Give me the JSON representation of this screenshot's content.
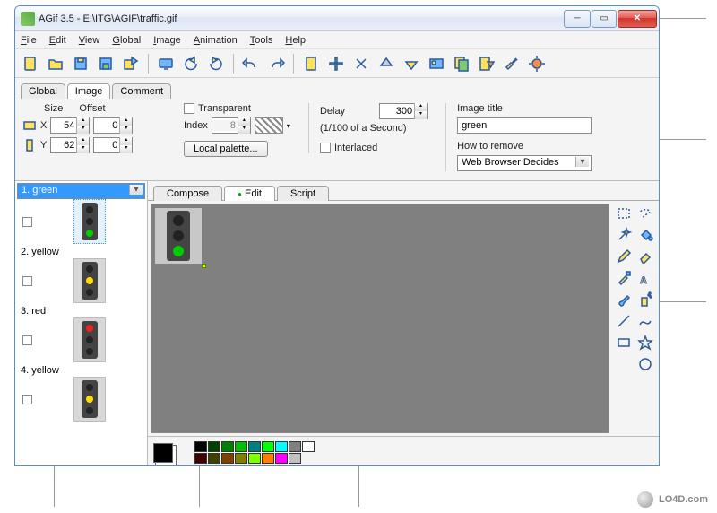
{
  "window": {
    "title": "AGif 3.5 - E:\\ITG\\AGIF\\traffic.gif"
  },
  "menu": {
    "file": "File",
    "edit": "Edit",
    "view": "View",
    "global": "Global",
    "image": "Image",
    "animation": "Animation",
    "tools": "Tools",
    "help": "Help"
  },
  "main_tabs": {
    "global": "Global",
    "image": "Image",
    "comment": "Comment"
  },
  "panel": {
    "size_label": "Size",
    "offset_label": "Offset",
    "x_label": "X",
    "x_size": "54",
    "x_offset": "0",
    "y_label": "Y",
    "y_size": "62",
    "y_offset": "0",
    "transparent_label": "Transparent",
    "index_label": "Index",
    "index_value": "8",
    "local_palette_btn": "Local palette...",
    "delay_label": "Delay",
    "delay_value": "300",
    "delay_unit": "(1/100 of a Second)",
    "interlaced_label": "Interlaced",
    "image_title_label": "Image title",
    "image_title_value": "green",
    "how_remove_label": "How to remove",
    "how_remove_value": "Web Browser Decides"
  },
  "frames": [
    {
      "label": "1. green",
      "lit": "green",
      "selected": true
    },
    {
      "label": "2. yellow",
      "lit": "yellow",
      "selected": false
    },
    {
      "label": "3. red",
      "lit": "red",
      "selected": false
    },
    {
      "label": "4. yellow",
      "lit": "yellow",
      "selected": false
    }
  ],
  "subtabs": {
    "compose": "Compose",
    "edit": "Edit",
    "script": "Script"
  },
  "palette": {
    "current": "#000000",
    "row1": [
      "#000000",
      "#004000",
      "#008000",
      "#00c000",
      "#008080",
      "#00ff00",
      "#00ffff",
      "#808080",
      "#ffffff"
    ],
    "row2": [
      "#400000",
      "#404000",
      "#804000",
      "#808000",
      "#80ff00",
      "#ff8000",
      "#ff00ff",
      "#c0c0c0"
    ]
  },
  "watermark": "LO4D.com"
}
